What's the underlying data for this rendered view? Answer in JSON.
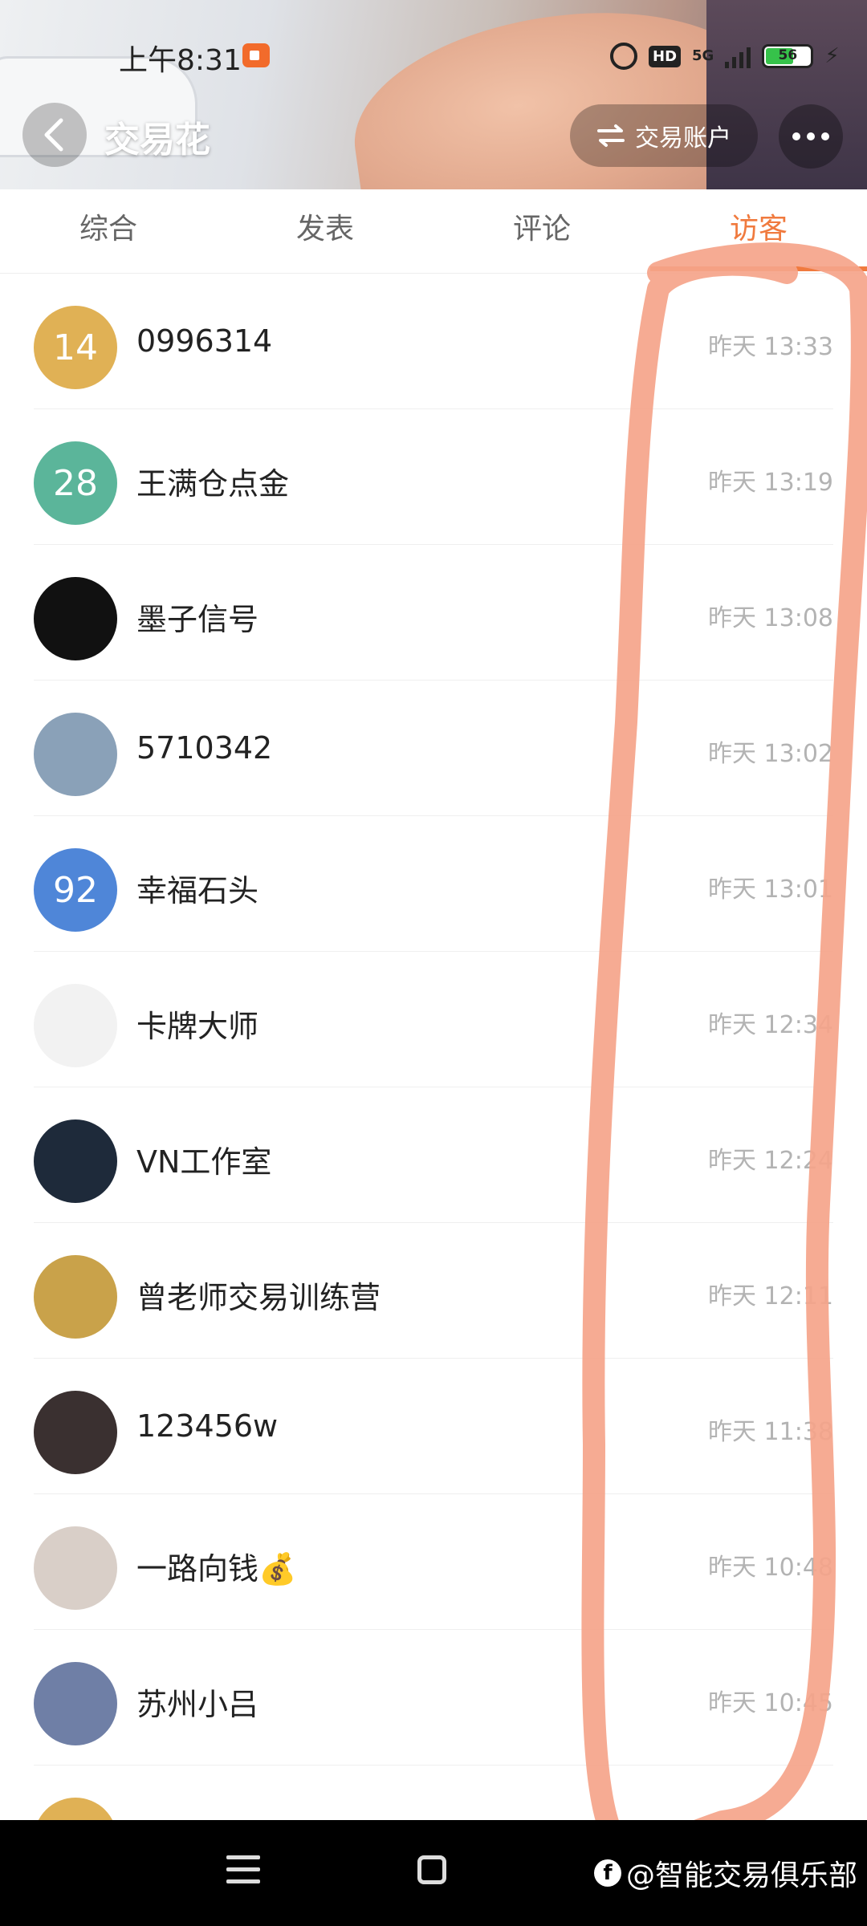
{
  "status_bar": {
    "time": "上午8:31",
    "network": "5G",
    "hd_label": "HD",
    "battery": "56"
  },
  "header": {
    "title": "交易花",
    "account_button": "交易账户"
  },
  "tabs": [
    "综合",
    "发表",
    "评论",
    "访客"
  ],
  "active_tab": 3,
  "accent_color": "#f07a3e",
  "visitors": [
    {
      "name": "0996314",
      "time": "昨天 13:33",
      "avatar_text": "14",
      "avatar_color": "#e0b155"
    },
    {
      "name": "王满仓点金",
      "time": "昨天 13:19",
      "avatar_text": "28",
      "avatar_color": "#5bb59a"
    },
    {
      "name": "墨子信号",
      "time": "昨天 13:08",
      "avatar_text": "",
      "avatar_color": "#111111"
    },
    {
      "name": "5710342",
      "time": "昨天 13:02",
      "avatar_text": "",
      "avatar_color": "#8aa1b8"
    },
    {
      "name": "幸福石头",
      "time": "昨天 13:01",
      "avatar_text": "92",
      "avatar_color": "#4f86d8"
    },
    {
      "name": "卡牌大师",
      "time": "昨天 12:34",
      "avatar_text": "",
      "avatar_color": "#f2f2f2"
    },
    {
      "name": "VN工作室",
      "time": "昨天 12:24",
      "avatar_text": "",
      "avatar_color": "#1e2a3a"
    },
    {
      "name": "曾老师交易训练营",
      "time": "昨天 12:11",
      "avatar_text": "",
      "avatar_color": "#c9a24a"
    },
    {
      "name": "123456w",
      "time": "昨天 11:38",
      "avatar_text": "",
      "avatar_color": "#3a3030"
    },
    {
      "name": "一路向钱💰",
      "time": "昨天 10:48",
      "avatar_text": "",
      "avatar_color": "#d9cfc8"
    },
    {
      "name": "苏州小吕",
      "time": "昨天 10:45",
      "avatar_text": "",
      "avatar_color": "#6f7fa6"
    },
    {
      "name": "",
      "time": "",
      "avatar_text": "",
      "avatar_color": "#e0b155"
    }
  ],
  "watermark": "@智能交易俱乐部"
}
